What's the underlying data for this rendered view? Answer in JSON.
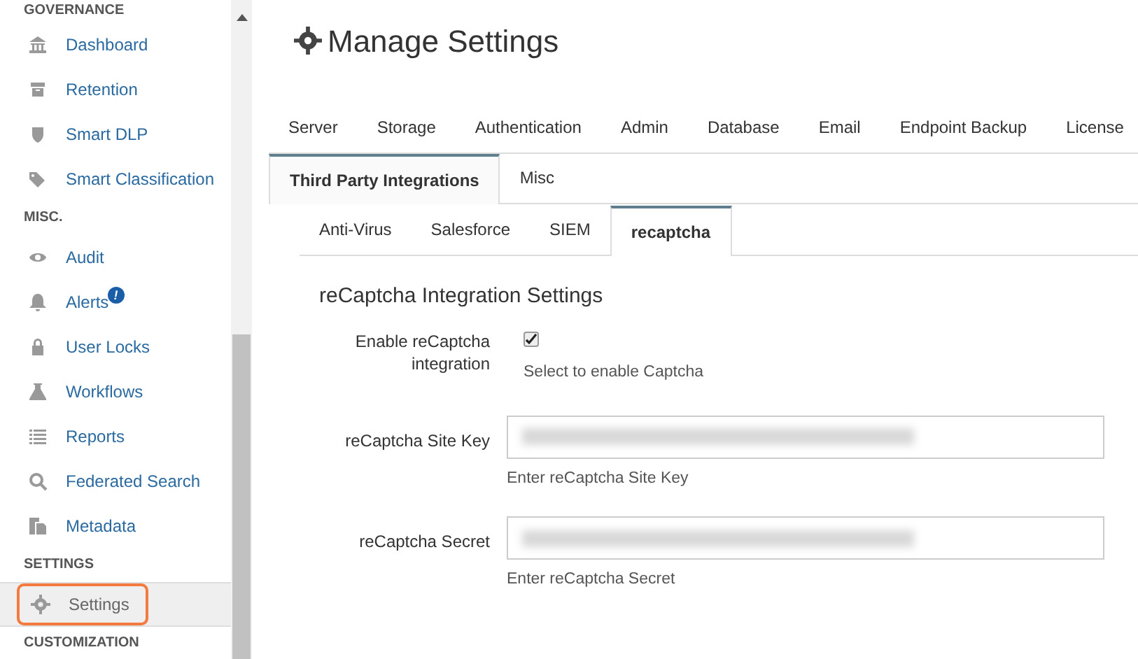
{
  "sidebar": {
    "sections": [
      {
        "heading": "GOVERNANCE",
        "items": [
          {
            "label": "Dashboard",
            "selected": false
          },
          {
            "label": "Retention",
            "selected": false
          },
          {
            "label": "Smart DLP",
            "selected": false
          },
          {
            "label": "Smart Classification",
            "selected": false
          }
        ]
      },
      {
        "heading": "MISC.",
        "items": [
          {
            "label": "Audit",
            "selected": false
          },
          {
            "label": "Alerts",
            "selected": false,
            "badge": "!"
          },
          {
            "label": "User Locks",
            "selected": false
          },
          {
            "label": "Workflows",
            "selected": false
          },
          {
            "label": "Reports",
            "selected": false
          },
          {
            "label": "Federated Search",
            "selected": false
          },
          {
            "label": "Metadata",
            "selected": false
          }
        ]
      },
      {
        "heading": "SETTINGS",
        "items": [
          {
            "label": "Settings",
            "selected": true,
            "highlighted": true
          }
        ]
      },
      {
        "heading": "CUSTOMIZATION"
      }
    ]
  },
  "page": {
    "title": "Manage Settings"
  },
  "tabs": [
    [
      {
        "label": "Server",
        "selected": false
      },
      {
        "label": "Storage",
        "selected": false
      },
      {
        "label": "Authentication",
        "selected": false
      },
      {
        "label": "Admin",
        "selected": false
      },
      {
        "label": "Database",
        "selected": false
      },
      {
        "label": "Email",
        "selected": false
      },
      {
        "label": "Endpoint Backup",
        "selected": false
      },
      {
        "label": "License",
        "selected": false
      }
    ],
    [
      {
        "label": "Third Party Integrations",
        "selected": true
      },
      {
        "label": "Misc",
        "selected": false
      }
    ]
  ],
  "subtabs": [
    {
      "label": "Anti-Virus",
      "selected": false
    },
    {
      "label": "Salesforce",
      "selected": false
    },
    {
      "label": "SIEM",
      "selected": false
    },
    {
      "label": "recaptcha",
      "selected": true
    }
  ],
  "form": {
    "title": "reCaptcha Integration Settings",
    "fields": [
      {
        "kind": "checkbox",
        "label": "Enable reCaptcha integration",
        "checked": true,
        "help": "Select to enable Captcha"
      },
      {
        "kind": "text",
        "label": "reCaptcha Site Key",
        "help": "Enter reCaptcha Site Key"
      },
      {
        "kind": "text",
        "label": "reCaptcha Secret",
        "help": "Enter reCaptcha Secret"
      }
    ]
  }
}
